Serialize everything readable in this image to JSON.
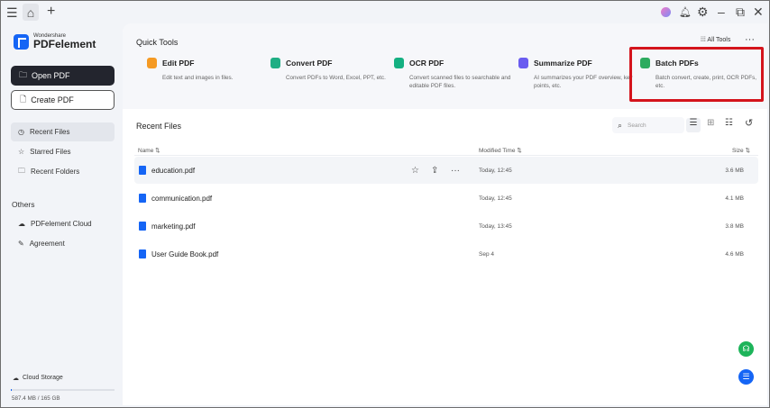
{
  "titlebar": {
    "menu_icon": "☰",
    "home_icon": "⌂",
    "add_tab_icon": "+",
    "minimize": "–",
    "restore": "⧉",
    "close": "✕"
  },
  "brand": {
    "company": "Wondershare",
    "product": "PDFelement"
  },
  "sidebar": {
    "open_pdf": "Open PDF",
    "create_pdf": "Create PDF",
    "items": [
      {
        "label": "Recent Files"
      },
      {
        "label": "Starred Files"
      },
      {
        "label": "Recent Folders"
      }
    ],
    "others_heading": "Others",
    "others": [
      {
        "label": "PDFelement Cloud"
      },
      {
        "label": "Agreement"
      }
    ],
    "cloud_storage": "Cloud Storage",
    "storage_usage": "587.4 MB / 165 GB",
    "storage_fraction": 0.0035
  },
  "quick_tools": {
    "title": "Quick Tools",
    "all_tools": "All Tools",
    "tools": [
      {
        "name": "Edit PDF",
        "desc": "Edit text and images in files.",
        "color": "#f59a23"
      },
      {
        "name": "Convert PDF",
        "desc": "Convert PDFs to Word, Excel, PPT, etc.",
        "color": "#1fae84"
      },
      {
        "name": "OCR PDF",
        "desc": "Convert scanned files to searchable and editable PDF files.",
        "color": "#14b081"
      },
      {
        "name": "Summarize PDF",
        "desc": "AI summarizes your PDF overview, key points, etc.",
        "color": "#6a5cf0"
      },
      {
        "name": "Batch PDFs",
        "desc": "Batch convert, create, print, OCR PDFs, etc.",
        "color": "#2dab5f"
      }
    ]
  },
  "recent": {
    "title": "Recent Files",
    "search_placeholder": "Search",
    "columns": {
      "name": "Name ⇅",
      "modified": "Modified Time ⇅",
      "size": "Size ⇅"
    },
    "files": [
      {
        "name": "education.pdf",
        "modified": "Today, 12:45",
        "size": "3.6 MB"
      },
      {
        "name": "communication.pdf",
        "modified": "Today, 12:45",
        "size": "4.1 MB"
      },
      {
        "name": "marketing.pdf",
        "modified": "Today, 13:45",
        "size": "3.8 MB"
      },
      {
        "name": "User Guide Book.pdf",
        "modified": "Sep 4",
        "size": "4.6 MB"
      }
    ]
  }
}
